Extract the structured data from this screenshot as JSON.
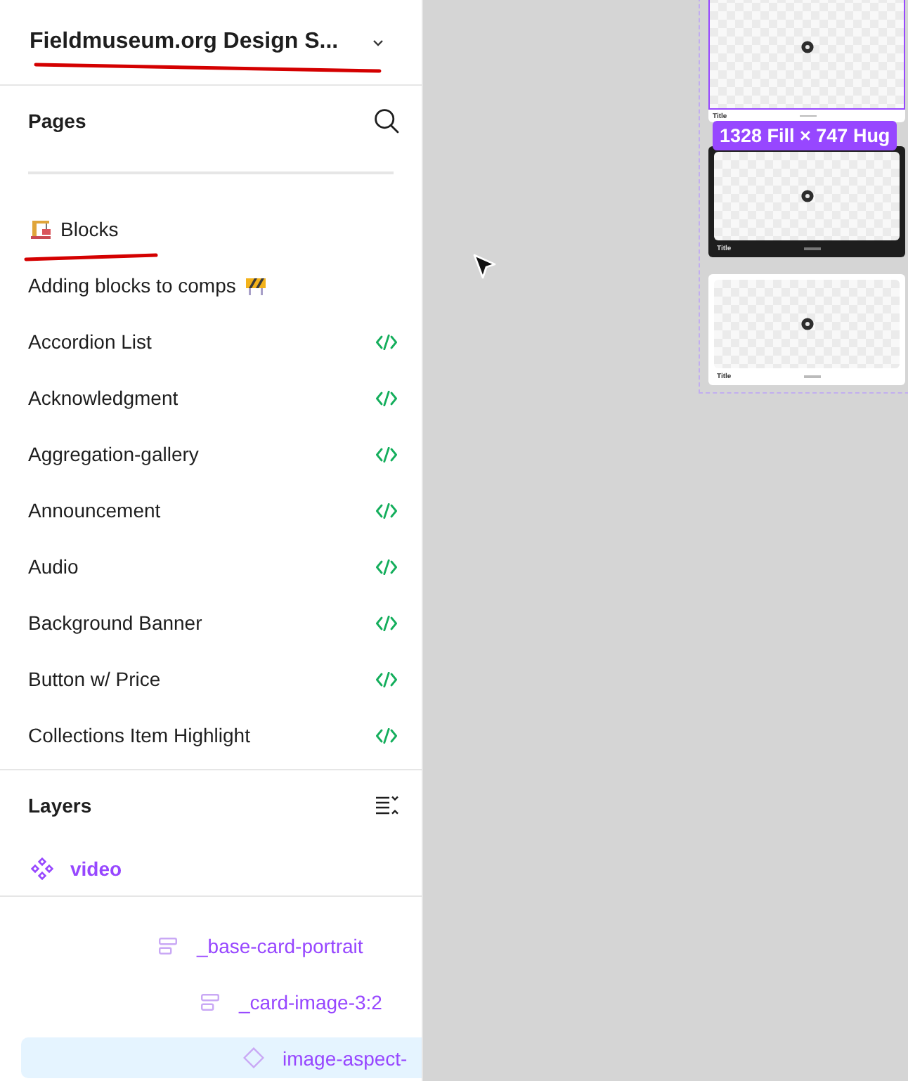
{
  "file": {
    "title": "Fieldmuseum.org Design S...",
    "underlined": true
  },
  "pages": {
    "heading": "Pages",
    "items": [
      {
        "label": "Blocks",
        "kind": "section",
        "underlined": true
      },
      {
        "label": "Adding blocks to comps",
        "kind": "wip",
        "underlined": false
      },
      {
        "label": "Accordion List",
        "kind": "block",
        "underlined": false
      },
      {
        "label": "Acknowledgment",
        "kind": "block",
        "underlined": false
      },
      {
        "label": "Aggregation-gallery",
        "kind": "block",
        "underlined": false
      },
      {
        "label": "Announcement",
        "kind": "block",
        "underlined": false
      },
      {
        "label": "Audio",
        "kind": "block",
        "underlined": false
      },
      {
        "label": "Background Banner",
        "kind": "block",
        "underlined": false
      },
      {
        "label": "Button w/ Price",
        "kind": "block",
        "underlined": false
      },
      {
        "label": "Collections Item Highlight",
        "kind": "block",
        "underlined": false
      }
    ]
  },
  "layers": {
    "heading": "Layers",
    "current": {
      "name": "video"
    },
    "tree": [
      {
        "name": "_base-card-portrait",
        "kind": "frame",
        "selected": false,
        "children": [
          {
            "name": "_card-image-3:2",
            "kind": "frame",
            "selected": false,
            "children": [
              {
                "name": "image-aspect-",
                "kind": "instance",
                "selected": true
              }
            ]
          }
        ]
      }
    ]
  },
  "canvas": {
    "frames": [
      {
        "kind": "light",
        "selected": true,
        "caption": "Title"
      },
      {
        "kind": "dark",
        "selected": false,
        "caption": "Title"
      },
      {
        "kind": "light",
        "selected": false,
        "caption": "Title"
      }
    ],
    "size_badge": "1328 Fill × 747 Hug"
  }
}
